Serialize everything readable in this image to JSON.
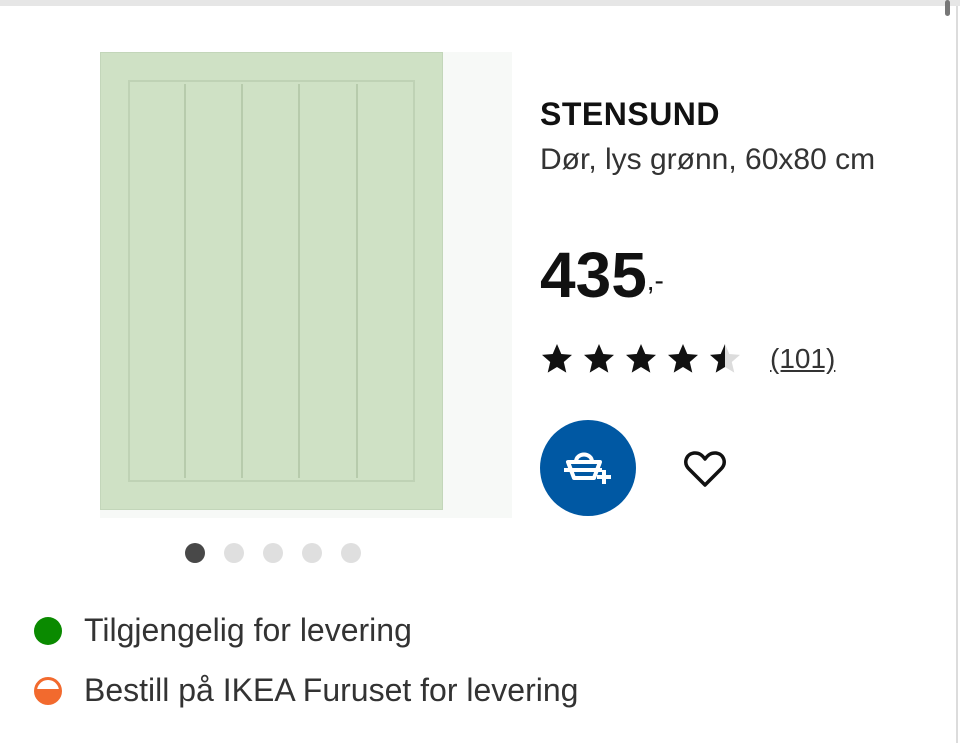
{
  "product": {
    "name": "STENSUND",
    "description": "Dør, lys grønn, 60x80 cm",
    "price": "435",
    "price_suffix": ",-",
    "rating": 4.5,
    "rating_max": 5,
    "review_count": "(101)",
    "image_icon": "door-product-image"
  },
  "carousel": {
    "count": 5,
    "active_index": 0
  },
  "buttons": {
    "add_to_cart_icon": "cart-add-icon",
    "favourite_icon": "heart-icon"
  },
  "availability": [
    {
      "text": "Tilgjengelig for levering",
      "status_color": "#0a8a00",
      "icon": "green-dot-icon"
    },
    {
      "text": "Bestill på IKEA Furuset for levering",
      "status_color": "#f26a2e",
      "icon": "half-orange-dot-icon"
    }
  ],
  "colors": {
    "brand_blue": "#0058a3",
    "door_green": "#cfe1c5"
  }
}
